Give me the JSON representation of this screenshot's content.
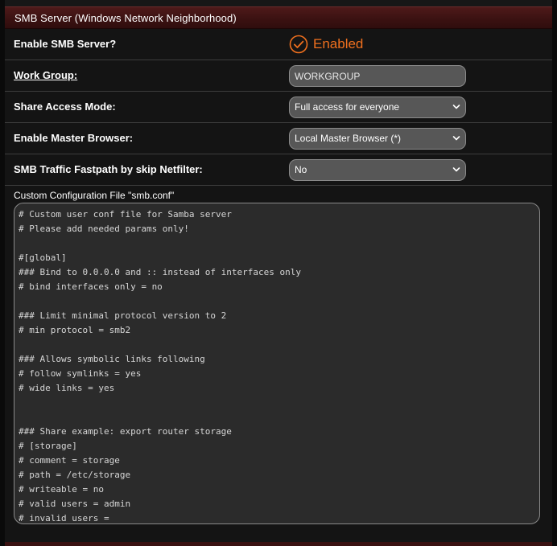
{
  "header": {
    "title": "SMB Server (Windows Network Neighborhood)"
  },
  "rows": {
    "enable_smb": {
      "label": "Enable SMB Server?",
      "value": "Enabled",
      "icon": "check-circle-icon"
    },
    "work_group": {
      "label": "Work Group:",
      "value": "WORKGROUP"
    },
    "share_access": {
      "label": "Share Access Mode:",
      "value": "Full access for everyone"
    },
    "master_browser": {
      "label": "Enable Master Browser:",
      "value": "Local Master Browser (*)"
    },
    "fastpath": {
      "label": "SMB Traffic Fastpath by skip Netfilter:",
      "value": "No"
    }
  },
  "config": {
    "label": "Custom Configuration File \"smb.conf\"",
    "content": "# Custom user conf file for Samba server\n# Please add needed params only!\n\n#[global]\n### Bind to 0.0.0.0 and :: instead of interfaces only\n# bind interfaces only = no\n\n### Limit minimal protocol version to 2\n# min protocol = smb2\n\n### Allows symbolic links following\n# follow symlinks = yes\n# wide links = yes\n\n\n### Share example: export router storage\n# [storage]\n# comment = storage\n# path = /etc/storage\n# writeable = no\n# valid users = admin\n# invalid users ="
  },
  "colors": {
    "accent": "#f0701e",
    "header_bg": "#3a1111",
    "field_bg": "#575757"
  }
}
